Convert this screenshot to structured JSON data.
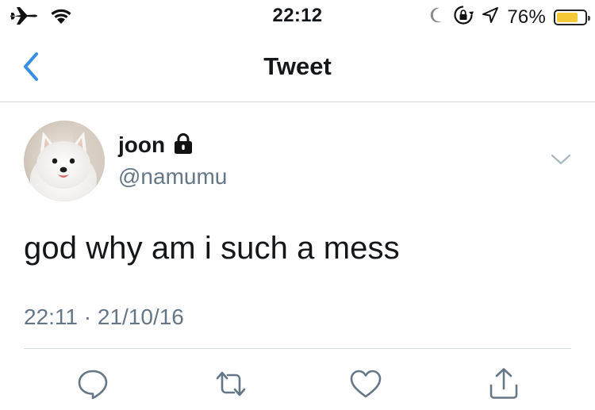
{
  "status_bar": {
    "time": "22:12",
    "battery_percent_label": "76%",
    "battery_level": 0.76,
    "battery_color": "#f5c836",
    "left_icons": [
      "airplane-icon",
      "wifi-icon"
    ],
    "right_icons": [
      "moon-icon",
      "rotation-lock-icon",
      "location-icon"
    ]
  },
  "nav": {
    "back_icon": "chevron-left-icon",
    "title": "Tweet",
    "accent_color": "#3a8ee6"
  },
  "tweet": {
    "display_name": "joon",
    "protected_icon": "lock-icon",
    "handle": "@namumu",
    "menu_icon": "chevron-down-icon",
    "text": "god why am i such a mess",
    "timestamp": "22:11 · 21/10/16"
  },
  "actions": [
    {
      "name": "reply",
      "icon": "reply-icon"
    },
    {
      "name": "retweet",
      "icon": "retweet-icon"
    },
    {
      "name": "like",
      "icon": "heart-icon"
    },
    {
      "name": "share",
      "icon": "share-icon"
    }
  ],
  "colors": {
    "text_primary": "#14171a",
    "text_secondary": "#657786",
    "icon_gray": "#657786",
    "divider": "#d8dde1"
  }
}
